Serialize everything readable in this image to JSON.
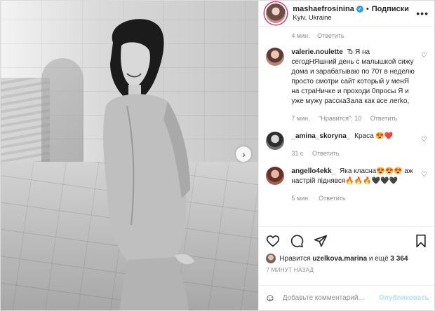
{
  "post": {
    "username": "mashaefrosinina",
    "follow_label": "Подписки",
    "location": "Kyiv, Ukraine",
    "verified_icon": "verified-badge-icon",
    "more_icon": "more-horizontal-icon"
  },
  "first_meta": {
    "time": "4 мин.",
    "reply": "Ответить"
  },
  "comments": [
    {
      "user": "valerie.noulette",
      "text": "Ђ Я на сегодНЯшний день с малышкой сижу дома и зарабатываю по 70т в неделю просто смотри сайт который у менЯ на страНичке и проходи 0просы Я и уже мужу расскаЗала как все лerko,",
      "time": "7 мин.",
      "likes": "\"Нравится\": 10",
      "reply": "Ответить"
    },
    {
      "user": "_amina_skoryna_",
      "text": "Краса 😍❤️",
      "time": "31 с",
      "reply": "Ответить"
    },
    {
      "user": "angello4ekk_",
      "text": "Яка класна😍😍😍 аж настрій піднявся🔥🔥🔥🖤🖤🖤",
      "time": "5 мин.",
      "reply": "Ответить"
    }
  ],
  "actions": {
    "like_icon": "heart-icon",
    "comment_icon": "comment-icon",
    "share_icon": "share-icon",
    "save_icon": "bookmark-icon"
  },
  "likes": {
    "prefix": "Нравится",
    "user": "uzelkova.marina",
    "middle": "и ещё",
    "count": "3 364"
  },
  "time_ago": "7 МИНУТ НАЗАД",
  "add_comment": {
    "placeholder": "Добавьте комментарий...",
    "publish": "Опубликовать",
    "emoji_icon": "smiley-icon"
  },
  "colors": {
    "accent_blue": "#3897f0",
    "publish_disabled": "#b2dffc",
    "muted": "#8e8e8e",
    "border": "#dbdbdb"
  }
}
